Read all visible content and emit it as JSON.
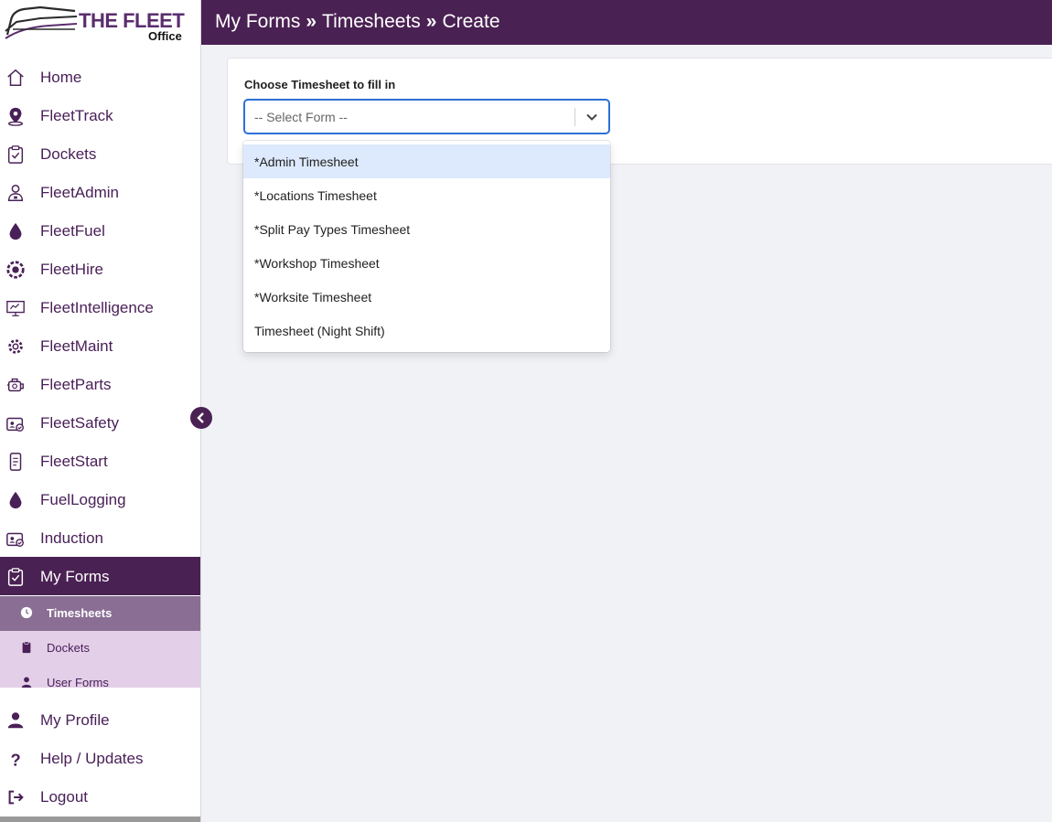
{
  "brand": {
    "name": "THE FLEET",
    "sub": "Office"
  },
  "header": {
    "parts": [
      "My Forms",
      "Timesheets",
      "Create"
    ],
    "separator": "»"
  },
  "sidebar": {
    "items": [
      {
        "label": "Home",
        "icon": "home-icon"
      },
      {
        "label": "FleetTrack",
        "icon": "location-pin-icon"
      },
      {
        "label": "Dockets",
        "icon": "clipboard-check-icon"
      },
      {
        "label": "FleetAdmin",
        "icon": "user-admin-icon"
      },
      {
        "label": "FleetFuel",
        "icon": "fuel-drop-icon"
      },
      {
        "label": "FleetHire",
        "icon": "hire-badge-icon"
      },
      {
        "label": "FleetIntelligence",
        "icon": "presentation-icon"
      },
      {
        "label": "FleetMaint",
        "icon": "gear-icon"
      },
      {
        "label": "FleetParts",
        "icon": "engine-icon"
      },
      {
        "label": "FleetSafety",
        "icon": "id-card-icon"
      },
      {
        "label": "FleetStart",
        "icon": "phone-checklist-icon"
      },
      {
        "label": "FuelLogging",
        "icon": "fuel-drop-icon"
      },
      {
        "label": "Induction",
        "icon": "id-card-icon"
      },
      {
        "label": "My Forms",
        "icon": "clipboard-check-icon",
        "active": true
      }
    ],
    "subitems": [
      {
        "label": "Timesheets",
        "icon": "clock-icon",
        "active": true
      },
      {
        "label": "Dockets",
        "icon": "clipboard-icon"
      },
      {
        "label": "User Forms",
        "icon": "user-icon"
      }
    ],
    "bottom": [
      {
        "label": "My Profile",
        "icon": "user-icon"
      },
      {
        "label": "Help / Updates",
        "icon": "question-icon"
      },
      {
        "label": "Logout",
        "icon": "logout-icon"
      }
    ]
  },
  "form": {
    "label": "Choose Timesheet to fill in",
    "placeholder": "-- Select Form --",
    "options": [
      "*Admin Timesheet",
      "*Locations Timesheet",
      "*Split Pay Types Timesheet",
      "*Workshop Timesheet",
      "*Worksite Timesheet",
      "Timesheet (Night Shift)"
    ],
    "highlighted_option": "*Admin Timesheet"
  },
  "colors": {
    "brand": "#4a2153",
    "accent": "#2d6fd6",
    "highlight": "#dde9fc",
    "submenu": "#e3cfe8"
  }
}
